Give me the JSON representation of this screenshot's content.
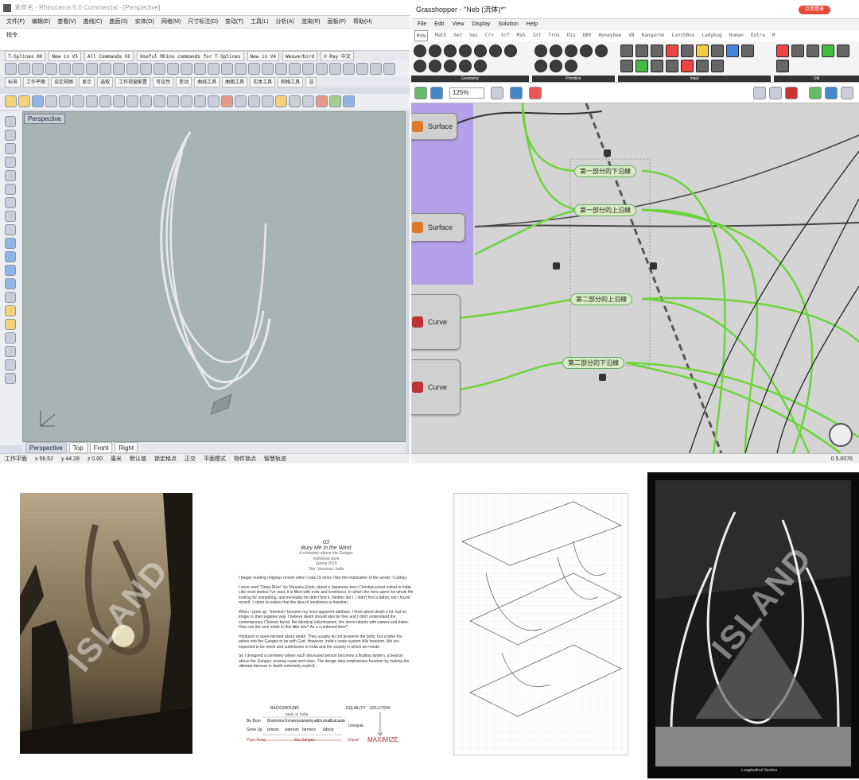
{
  "rhino": {
    "title": "未命名 - Rhinoceros 5.0 Commercial - [Perspective]",
    "menu": [
      "文件(F)",
      "编辑(E)",
      "查看(V)",
      "曲线(C)",
      "曲面(S)",
      "实体(O)",
      "网格(M)",
      "尺寸标注(D)",
      "变动(T)",
      "工具(L)",
      "分析(A)",
      "渲染(R)",
      "面板(P)",
      "帮助(H)"
    ],
    "command_label": "指令:",
    "toolbar_tabs": [
      "T-Splines 00",
      "New in V5",
      "All Commands GC",
      "Useful Rhino commands for T-Splines",
      "New in V4",
      "Weaverbird",
      "V-Ray 中文"
    ],
    "panel_tabs": [
      "标准",
      "工作平面",
      "设定视图",
      "显示",
      "选取",
      "工作视窗配置",
      "可见性",
      "变动",
      "曲线工具",
      "曲面工具",
      "实体工具",
      "网格工具",
      "渲"
    ],
    "viewport_label": "Perspective",
    "viewport_tabs": [
      "Perspective",
      "Top",
      "Front",
      "Right"
    ],
    "status": [
      "工作平面",
      "x 56.52",
      "y 44.28",
      "z 0.00",
      "毫米",
      "默认值",
      "锁定格点",
      "正交",
      "平面模式",
      "物件锁点",
      "智慧轨迹"
    ]
  },
  "gh": {
    "title": "Grasshopper - \"Neb (流体)*\"",
    "signin_button": "点我登录",
    "menu": [
      "File",
      "Edit",
      "View",
      "Display",
      "Solution",
      "Help"
    ],
    "tabs": [
      "Prm",
      "Math",
      "Set",
      "Vec",
      "Crv",
      "Srf",
      "Msh",
      "Int",
      "Trns",
      "Dis",
      "DBV",
      "Honeybee",
      "VB",
      "Kangaroo",
      "LunchBox",
      "Ladybug",
      "Human",
      "Extra",
      "M"
    ],
    "ribbon_groups": [
      "Geometry",
      "Primitive",
      "Input",
      "Util"
    ],
    "zoom": "125%",
    "components": [
      {
        "label": "Surface"
      },
      {
        "label": "Surface"
      },
      {
        "label": "Curve"
      },
      {
        "label": "Curve"
      }
    ],
    "relays": [
      "第一部分的下沿線",
      "第一部分的上沿線",
      "第二部分的上沿線",
      "第二部分的下沿線"
    ],
    "status": "0.5.0076"
  },
  "document": {
    "number": "03",
    "title": "Bury Me in the Wind",
    "subtitle": "A cemetery above the Ganges",
    "meta": [
      "Individual work",
      "Spring 2015",
      "Site: Varanasi, India"
    ],
    "paragraphs": [
      "I began reading religious novels when I was 15 since I like the implication of the words ~Cathay.",
      "I once read \"Deep River\" by Shusaku Endo, about a Japanese-born Christian priest exiled in India. Like most stories I've read, it is filled with exile and loneliness, in which the hero spent his whole life looking for something, and inevitably he didn't find it. Neither did I. I didn't find a father, but I found myself. I came to realize that the idea of loneliness is freedom.",
      "When I grew up, \"freedom\" became my most apparent attribute. I think about death a lot, but no longer in that negative way. I believe death should also be free and I don't understand the contemporary Chinese burial, the identical columbarium, the stone tablets with names and dates. How can the soul settle in this little box? As a numbered item?",
      "Hinduism is open-minded about death. They usually do not preserve the body, but scatter the ashes into the Ganges to be with God. However, India's caste system kills freedom. We are expected to be meek and submissive in India and the society in which we reside.",
      "So I designed a cemetery where each deceased person becomes a floating lantern, a beacon above the Ganges, erasing caste and class. The design idea emphasizes freedom by making the ultimate fairness in death extremely explicit."
    ],
    "diagram": {
      "background": "BACKGROUND",
      "equality": "EQUALITY",
      "solution": "SOLUTION",
      "caste": "caste in India",
      "row1": "Be Born",
      "row2": "Grow Up",
      "row3": "Pass Away",
      "cols": [
        "Brahmins",
        "Kshatriyas",
        "Vaishyas",
        "Shudras",
        "Outcaste"
      ],
      "priests": "priests",
      "warriors": "warriors",
      "farmers": "farmers",
      "labour": "labour",
      "unequal": "Unequal",
      "ganges": "the Ganges",
      "equal": "Equal",
      "maximize": "MAXIMIZE"
    }
  },
  "images": {
    "watermark": "ISLAND",
    "board_caption": "Longitudinal Section"
  }
}
